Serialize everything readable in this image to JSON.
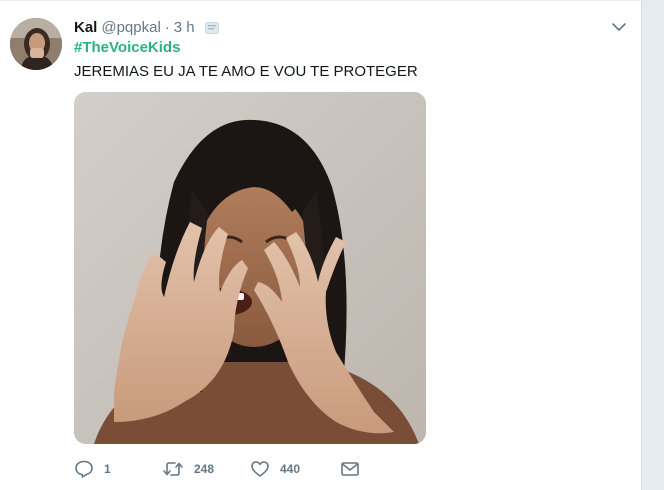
{
  "tweet": {
    "display_name": "Kal",
    "handle": "@pqpkal",
    "separator": "·",
    "timestamp": "3 h",
    "hashtag": "#TheVoiceKids",
    "text": "JEREMIAS EU JA TE AMO E VOU TE PROTEGER"
  },
  "actions": {
    "reply_count": "1",
    "retweet_count": "248",
    "like_count": "440"
  },
  "colors": {
    "hashtag": "#2bb37b",
    "secondary_text": "#657786",
    "primary_text": "#14171a"
  },
  "icons": {
    "reply": "reply-icon",
    "retweet": "retweet-icon",
    "like": "heart-icon",
    "message": "envelope-icon",
    "menu": "chevron-down-icon",
    "translate": "translate-icon"
  }
}
